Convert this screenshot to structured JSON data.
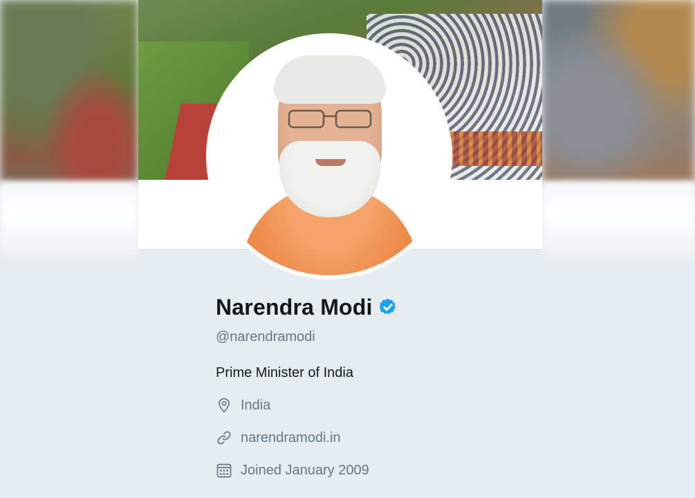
{
  "profile": {
    "name": "Narendra Modi",
    "verified": true,
    "handle": "@narendramodi",
    "bio": "Prime Minister of India",
    "location": "India",
    "website": "narendramodi.in",
    "joined": "Joined January 2009"
  },
  "icons": {
    "verified": "verified-badge-icon",
    "location": "location-pin-icon",
    "link": "link-icon",
    "calendar": "calendar-icon"
  },
  "colors": {
    "background": "#e6ecf0",
    "name": "#14171a",
    "secondary_text": "#657786",
    "verified_blue": "#1da1f2"
  }
}
